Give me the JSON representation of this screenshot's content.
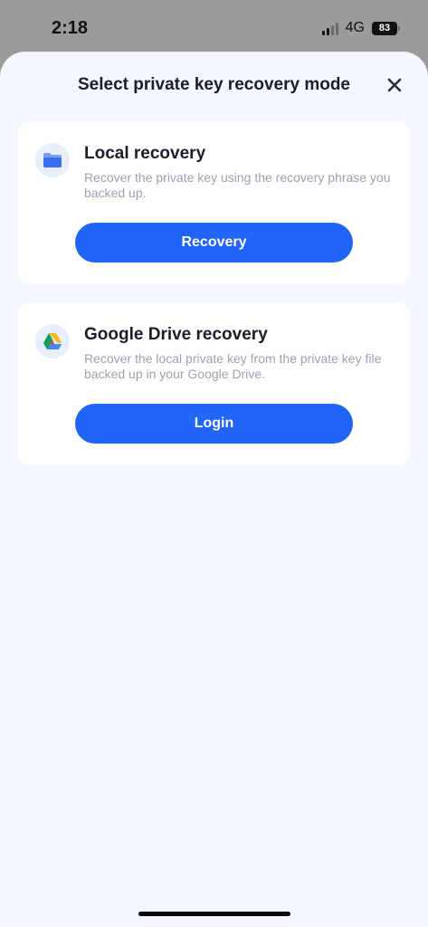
{
  "status_bar": {
    "time": "2:18",
    "network": "4G",
    "battery": "83"
  },
  "sheet": {
    "title": "Select private key recovery mode"
  },
  "local_card": {
    "title": "Local recovery",
    "description": "Recover the private key using the recovery phrase you backed up.",
    "button_label": "Recovery",
    "icon": "folder-icon"
  },
  "drive_card": {
    "title": "Google Drive recovery",
    "description": "Recover the local private key from the private key file backed up in your Google Drive.",
    "button_label": "Login",
    "icon": "google-drive-icon"
  },
  "colors": {
    "accent": "#2165f6",
    "sheet_background": "#f4f7fd",
    "card_background": "#ffffff",
    "title_text": "#1b1d2a",
    "secondary_text": "#9ba1b3"
  }
}
